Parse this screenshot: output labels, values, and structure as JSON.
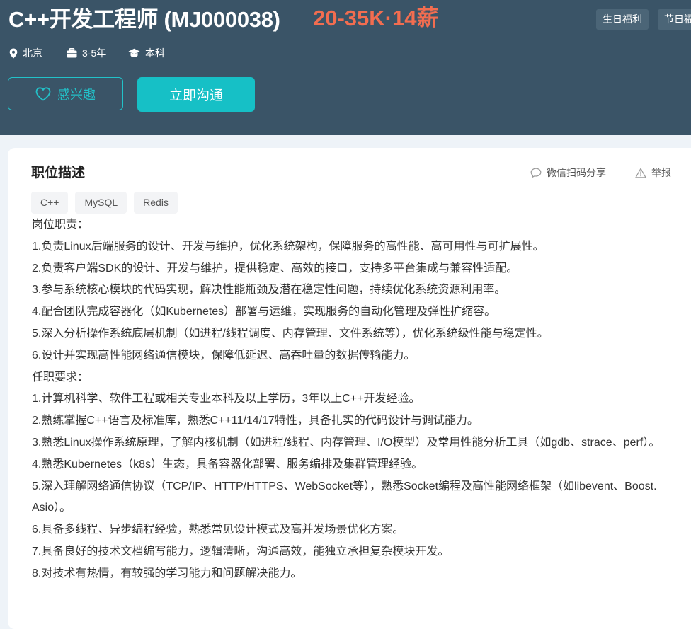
{
  "header": {
    "title": "C++开发工程师 (MJ000038)",
    "salary": "20-35K·14薪",
    "welfare": [
      "生日福利",
      "节日福利"
    ],
    "meta": {
      "location": "北京",
      "experience": "3-5年",
      "education": "本科"
    },
    "buttons": {
      "interest": "感兴趣",
      "chat": "立即沟通"
    },
    "colors": {
      "header_bg": "#3a5467",
      "salary": "#f26d50",
      "accent": "#16c0c6"
    }
  },
  "card": {
    "section_title": "职位描述",
    "share": "微信扫码分享",
    "report": "举报",
    "tags": [
      "C++",
      "MySQL",
      "Redis"
    ],
    "description": [
      "岗位职责：",
      "1.负责Linux后端服务的设计、开发与维护，优化系统架构，保障服务的高性能、高可用性与可扩展性。",
      "2.负责客户端SDK的设计、开发与维护，提供稳定、高效的接口，支持多平台集成与兼容性适配。",
      "3.参与系统核心模块的代码实现，解决性能瓶颈及潜在稳定性问题，持续优化系统资源利用率。",
      "4.配合团队完成容器化（如Kubernetes）部署与运维，实现服务的自动化管理及弹性扩缩容。",
      "5.深入分析操作系统底层机制（如进程/线程调度、内存管理、文件系统等），优化系统级性能与稳定性。",
      "6.设计并实现高性能网络通信模块，保障低延迟、高吞吐量的数据传输能力。",
      "任职要求：",
      "1.计算机科学、软件工程或相关专业本科及以上学历，3年以上C++开发经验。",
      "2.熟练掌握C++语言及标准库，熟悉C++11/14/17特性，具备扎实的代码设计与调试能力。",
      "3.熟悉Linux操作系统原理，了解内核机制（如进程/线程、内存管理、I/O模型）及常用性能分析工具（如gdb、strace、perf）。",
      "4.熟悉Kubernetes（k8s）生态，具备容器化部署、服务编排及集群管理经验。",
      "5.深入理解网络通信协议（TCP/IP、HTTP/HTTPS、WebSocket等），熟悉Socket编程及高性能网络框架（如libevent、Boost.Asio）。",
      "6.具备多线程、异步编程经验，熟悉常见设计模式及高并发场景优化方案。",
      "7.具备良好的技术文档编写能力，逻辑清晰，沟通高效，能独立承担复杂模块开发。",
      "8.对技术有热情，有较强的学习能力和问题解决能力。"
    ]
  }
}
